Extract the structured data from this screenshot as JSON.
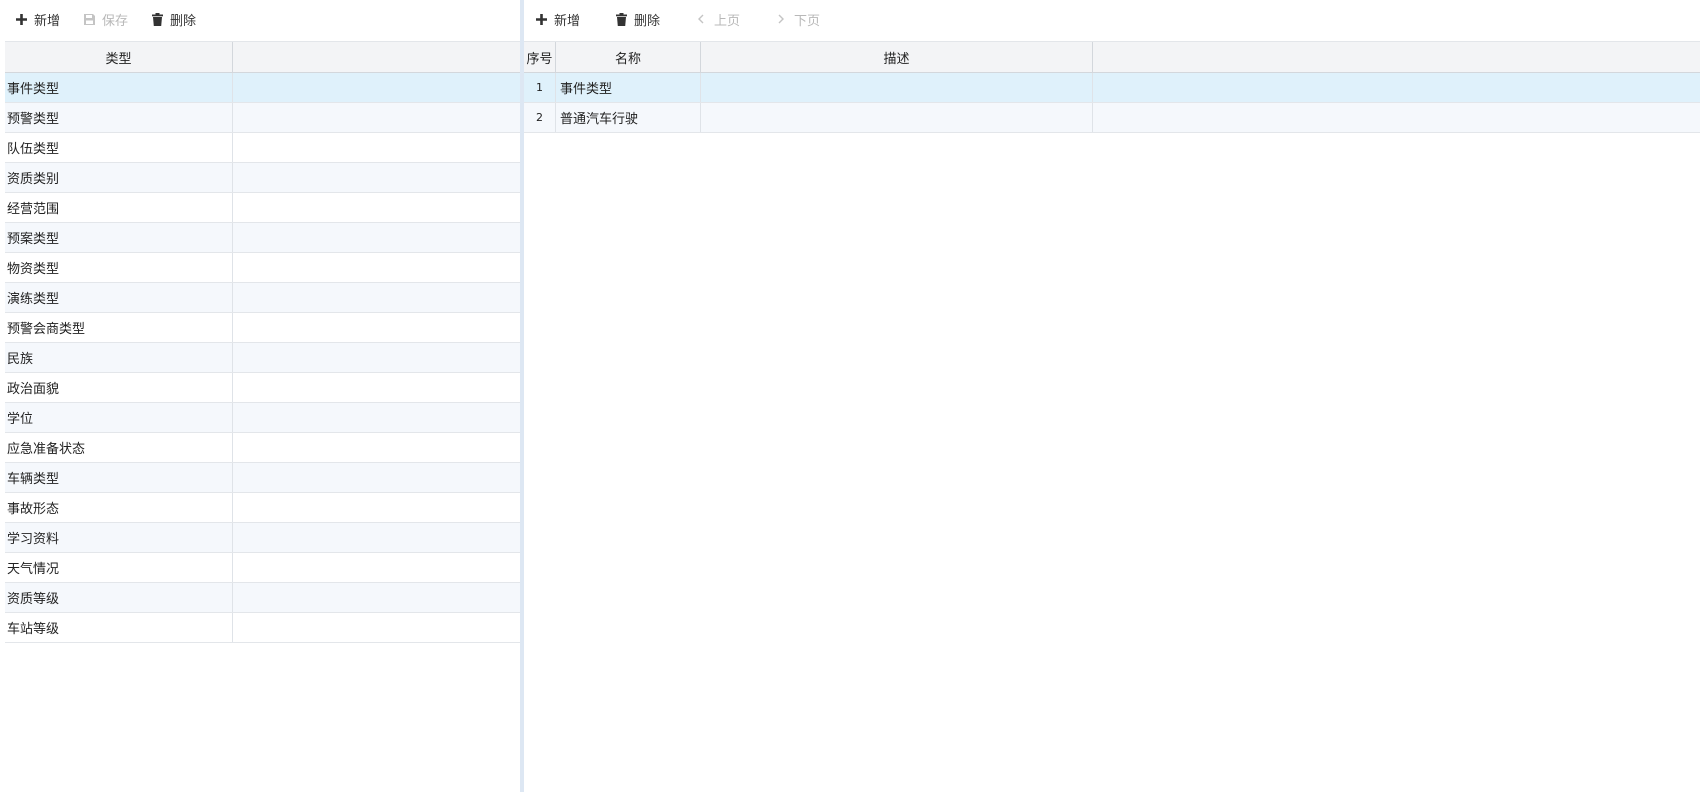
{
  "left_toolbar": {
    "add_label": "新增",
    "save_label": "保存",
    "delete_label": "删除"
  },
  "left_grid": {
    "header_type": "类型",
    "rows": [
      "事件类型",
      "预警类型",
      "队伍类型",
      "资质类别",
      "经营范围",
      "预案类型",
      "物资类型",
      "演练类型",
      "预警会商类型",
      "民族",
      "政治面貌",
      "学位",
      "应急准备状态",
      "车辆类型",
      "事故形态",
      "学习资料",
      "天气情况",
      "资质等级",
      "车站等级"
    ]
  },
  "right_toolbar": {
    "add_label": "新增",
    "delete_label": "删除",
    "prev_label": "上页",
    "next_label": "下页"
  },
  "right_grid": {
    "header_index": "序号",
    "header_name": "名称",
    "header_desc": "描述",
    "rows": [
      {
        "index": "1",
        "name": "事件类型",
        "desc": ""
      },
      {
        "index": "2",
        "name": "普通汽车行驶",
        "desc": ""
      }
    ]
  },
  "colors": {
    "selected_row": "#dff1fb",
    "alt_row": "#f5f8fc",
    "header_bg": "#f3f4f6",
    "splitter": "#dde7f3",
    "disabled_text": "#b8b8b8"
  }
}
